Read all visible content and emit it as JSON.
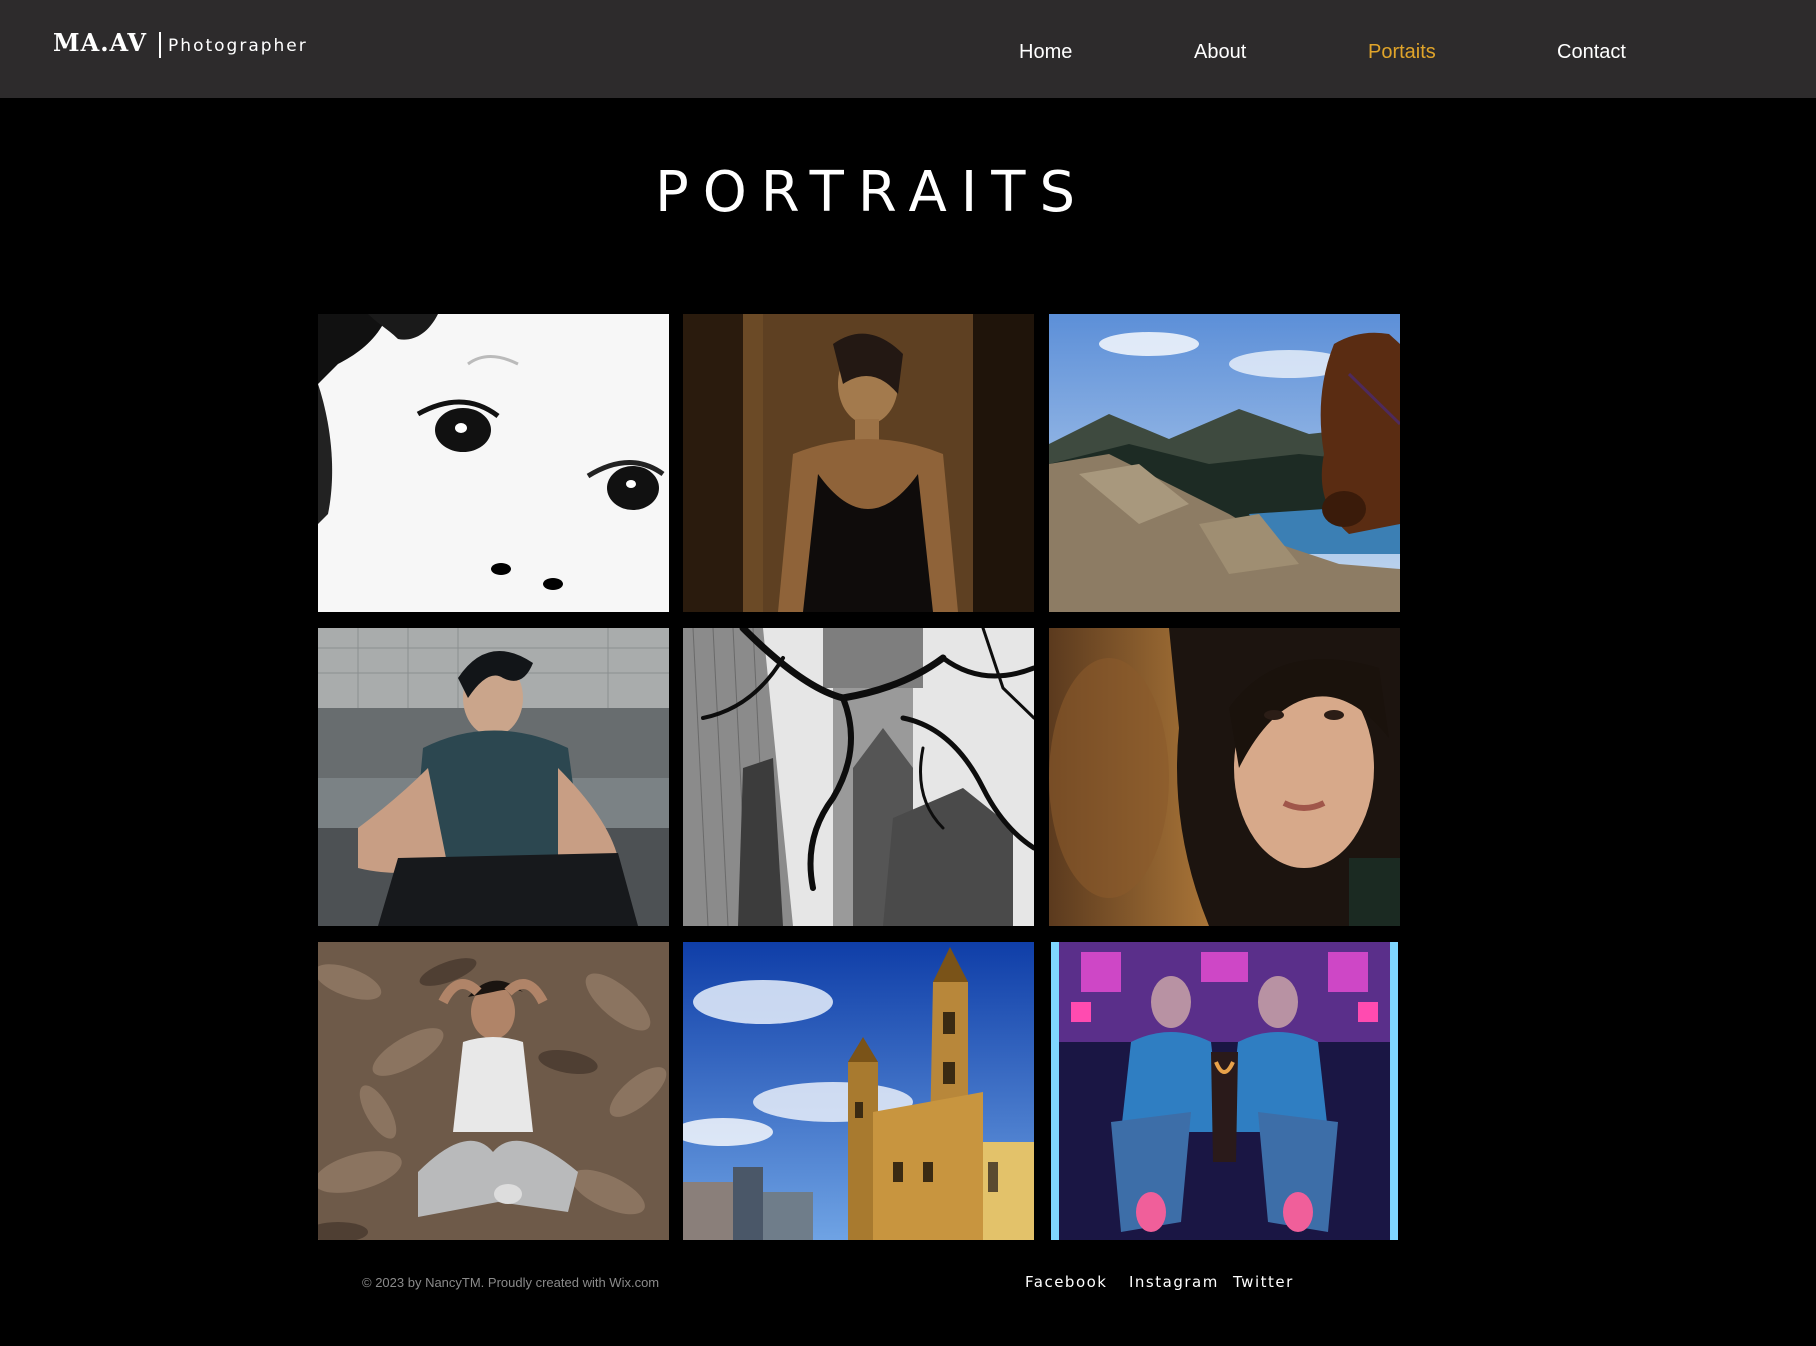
{
  "brand": {
    "mark": "MA.AV",
    "subtitle": "Photographer"
  },
  "nav": {
    "items": [
      {
        "label": "Home",
        "active": false
      },
      {
        "label": "About",
        "active": false
      },
      {
        "label": "Portaits",
        "active": true
      },
      {
        "label": "Contact",
        "active": false
      }
    ]
  },
  "page": {
    "title": "PORTRAITS"
  },
  "gallery": {
    "photos": [
      {
        "subject": "child face black and white"
      },
      {
        "subject": "woman in doorway black dress"
      },
      {
        "subject": "horse mountain lake"
      },
      {
        "subject": "man sitting teal shirt"
      },
      {
        "subject": "gothic tower with branches"
      },
      {
        "subject": "young woman close-up"
      },
      {
        "subject": "woman sitting in dry leaves"
      },
      {
        "subject": "cathedral blue sky"
      },
      {
        "subject": "mirrored neon portrait"
      }
    ]
  },
  "footer": {
    "copyright": "© 2023 by NancyTM. Proudly created with Wix.com",
    "social": [
      "Facebook",
      "Instagram",
      "Twitter"
    ]
  },
  "colors": {
    "header_bg": "#2d2b2c",
    "page_bg": "#000000",
    "accent": "#e0a42a"
  }
}
